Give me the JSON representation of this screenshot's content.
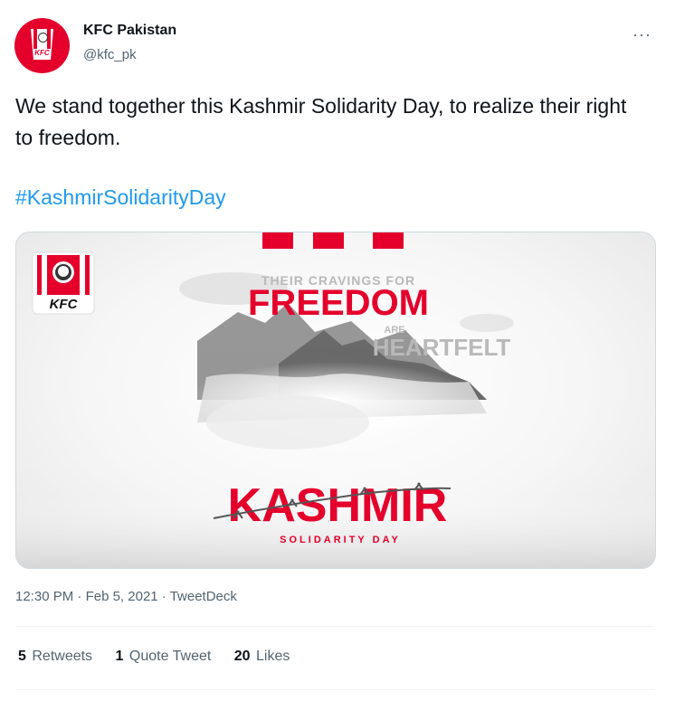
{
  "author": {
    "name": "KFC Pakistan",
    "handle": "@kfc_pk",
    "avatar_logo": "KFC"
  },
  "more_icon": "···",
  "tweet": {
    "text": "We stand together this Kashmir Solidarity Day, to realize their right to freedom.",
    "hashtag": "#KashmirSolidarityDay"
  },
  "media": {
    "logo_text": "KFC",
    "line1": "THEIR CRAVINGS FOR",
    "line2": "FREEDOM",
    "line3": "ARE",
    "line4": "HEARTFELT",
    "line5": "KASHMIR",
    "line6": "SOLIDARITY DAY",
    "colors": {
      "brand_red": "#e4002b",
      "text_gray": "#b9b9b9"
    }
  },
  "meta": {
    "time": "12:30 PM",
    "date": "Feb 5, 2021",
    "source": "TweetDeck",
    "separator": " · "
  },
  "stats": {
    "retweets_count": "5",
    "retweets_label": "Retweets",
    "quotes_count": "1",
    "quotes_label": "Quote Tweet",
    "likes_count": "20",
    "likes_label": "Likes"
  }
}
